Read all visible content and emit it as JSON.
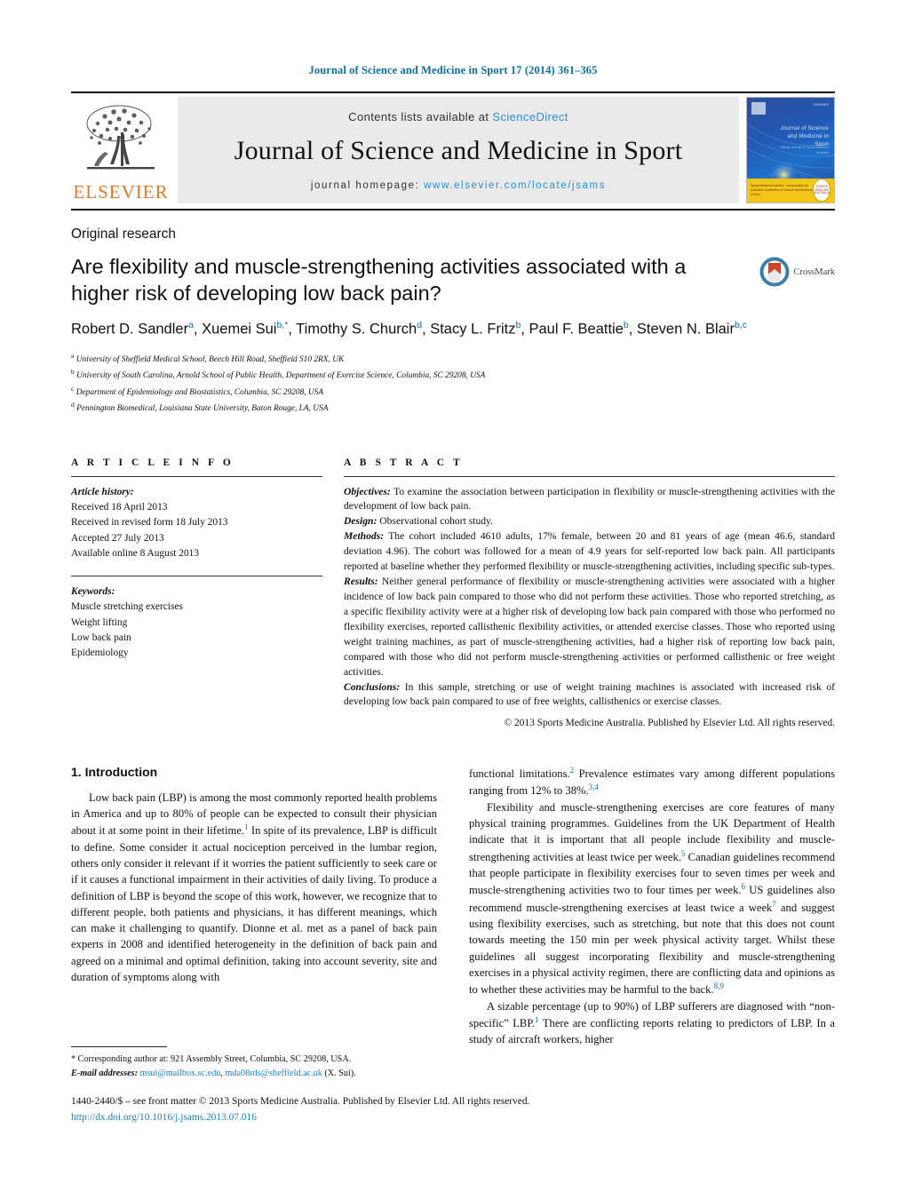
{
  "running_head": "Journal of Science and Medicine in Sport 17 (2014) 361–365",
  "masthead": {
    "publisher_word": "ELSEVIER",
    "contents_prefix": "Contents lists available at ",
    "contents_link": "ScienceDirect",
    "journal_title": "Journal of Science and Medicine in Sport",
    "homepage_prefix": "journal homepage: ",
    "homepage_url": "www.elsevier.com/locate/jsams",
    "cover": {
      "title": "Journal of Science and Medicine in Sport",
      "subtitle": "Official Journal of Sports Medicine Australia",
      "brand": "ELSEVIER",
      "foot_text": "Sports Medicine Australia · incorporating the Australian Conference of Science and Medicine in Sport",
      "badge_text": "SPORTS MEDICINE AUSTRALIA"
    }
  },
  "article": {
    "kicker": "Original research",
    "title": "Are flexibility and muscle-strengthening activities associated with a higher risk of developing low back pain?",
    "crossmark_label": "CrossMark",
    "authors_html": "Robert D. Sandler<sup>a</sup>, Xuemei Sui<sup>b,*</sup>, Timothy S. Church<sup>d</sup>, Stacy L. Fritz<sup>b</sup>, Paul F. Beattie<sup>b</sup>, Steven N. Blair<sup>b,c</sup>",
    "affiliations": [
      {
        "marker": "a",
        "text": "University of Sheffield Medical School, Beech Hill Road, Sheffield S10 2RX, UK"
      },
      {
        "marker": "b",
        "text": "University of South Carolina, Arnold School of Public Health, Department of Exercise Science, Columbia, SC 29208, USA"
      },
      {
        "marker": "c",
        "text": "Department of Epidemiology and Biostatistics, Columbia, SC 29208, USA"
      },
      {
        "marker": "d",
        "text": "Pennington Biomedical, Louisiana State University, Baton Rouge, LA, USA"
      }
    ]
  },
  "article_info": {
    "label": "A R T I C L E    I N F O",
    "history_label": "Article history:",
    "history": [
      "Received 18 April 2013",
      "Received in revised form 18 July 2013",
      "Accepted 27 July 2013",
      "Available online 8 August 2013"
    ],
    "keywords_label": "Keywords:",
    "keywords": [
      "Muscle stretching exercises",
      "Weight lifting",
      "Low back pain",
      "Epidemiology"
    ]
  },
  "abstract": {
    "label": "A B S T R A C T",
    "objectives_label": "Objectives:",
    "objectives": " To examine the association between participation in flexibility or muscle-strengthening activities with the development of low back pain.",
    "design_label": "Design:",
    "design": " Observational cohort study.",
    "methods_label": "Methods:",
    "methods": " The cohort included 4610 adults, 17% female, between 20 and 81 years of age (mean 46.6, standard deviation 4.96). The cohort was followed for a mean of 4.9 years for self-reported low back pain. All participants reported at baseline whether they performed flexibility or muscle-strengthening activities, including specific sub-types.",
    "results_label": "Results:",
    "results": " Neither general performance of flexibility or muscle-strengthening activities were associated with a higher incidence of low back pain compared to those who did not perform these activities. Those who reported stretching, as a specific flexibility activity were at a higher risk of developing low back pain compared with those who performed no flexibility exercises, reported callisthenic flexibility activities, or attended exercise classes. Those who reported using weight training machines, as part of muscle-strengthening activities, had a higher risk of reporting low back pain, compared with those who did not perform muscle-strengthening activities or performed callisthenic or free weight activities.",
    "conclusions_label": "Conclusions:",
    "conclusions": " In this sample, stretching or use of weight training machines is associated with increased risk of developing low back pain compared to use of free weights, callisthenics or exercise classes.",
    "copyright": "© 2013 Sports Medicine Australia. Published by Elsevier Ltd. All rights reserved."
  },
  "body": {
    "intro_heading": "1.  Introduction",
    "left_para_1_html": "Low back pain (LBP) is among the most commonly reported health problems in America and up to 80% of people can be expected to consult their physician about it at some point in their lifetime.<sup>1</sup> In spite of its prevalence, LBP is difficult to define. Some consider it actual nociception perceived in the lumbar region, others only consider it relevant if it worries the patient sufficiently to seek care or if it causes a functional impairment in their activities of daily living. To produce a definition of LBP is beyond the scope of this work, however, we recognize that to different people, both patients and physicians, it has different meanings, which can make it challenging to quantify. Dionne et al. met as a panel of back pain experts in 2008 and identified heterogeneity in the definition of back pain and agreed on a minimal and optimal definition, taking into account severity, site and duration of symptoms along with",
    "right_para_1_html": "functional limitations.<sup>2</sup> Prevalence estimates vary among different populations ranging from 12% to 38%.<sup>3,4</sup>",
    "right_para_2_html": "Flexibility and muscle-strengthening exercises are core features of many physical training programmes. Guidelines from the UK Department of Health indicate that it is important that all people include flexibility and muscle-strengthening activities at least twice per week.<sup>5</sup> Canadian guidelines recommend that people participate in flexibility exercises four to seven times per week and muscle-strengthening activities two to four times per week.<sup>6</sup> US guidelines also recommend muscle-strengthening exercises at least twice a week<sup>7</sup> and suggest using flexibility exercises, such as stretching, but note that this does not count towards meeting the 150 min per week physical activity target. Whilst these guidelines all suggest incorporating flexibility and muscle-strengthening exercises in a physical activity regimen, there are conflicting data and opinions as to whether these activities may be harmful to the back.<sup>8,9</sup>",
    "right_para_3_html": "A sizable percentage (up to 90%) of LBP sufferers are diagnosed with “non-specific” LBP.<sup>1</sup> There are conflicting reports relating to predictors of LBP. In a study of aircraft workers, higher"
  },
  "footnote": {
    "corresponding": "* Corresponding author at: 921 Assembly Street, Columbia, SC 29208, USA.",
    "email_label": "E-mail addresses:",
    "email_1": "msui@mailbox.sc.edu",
    "email_2": "mda08rds@sheffield.ac.uk",
    "email_suffix": "(X. Sui)."
  },
  "footer": {
    "copyright_line": "1440-2440/$ – see front matter © 2013 Sports Medicine Australia. Published by Elsevier Ltd. All rights reserved.",
    "doi": "http://dx.doi.org/10.1016/j.jsams.2013.07.016"
  },
  "colors": {
    "header_teal": "#0b6f9d",
    "link_blue": "#2a8fd4",
    "elsevier_orange": "#E87722",
    "crossmark_blue": "#3b7ea8",
    "crossmark_red": "#d1432a"
  }
}
